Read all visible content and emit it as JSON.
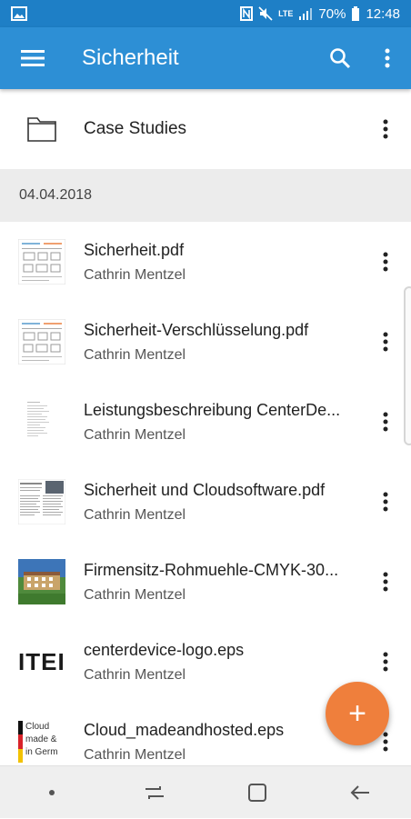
{
  "status_bar": {
    "battery_text": "70%",
    "time": "12:48",
    "network": "LTE"
  },
  "app_bar": {
    "title": "Sicherheit",
    "color": "#2d8fd5"
  },
  "folder": {
    "name": "Case Studies"
  },
  "date_group": {
    "label": "04.04.2018"
  },
  "files": [
    {
      "name": "Sicherheit.pdf",
      "owner": "Cathrin Mentzel",
      "thumb": "doc-chart"
    },
    {
      "name": "Sicherheit-Verschlüsselung.pdf",
      "owner": "Cathrin Mentzel",
      "thumb": "doc-chart"
    },
    {
      "name": "Leistungsbeschreibung CenterDe...",
      "owner": "Cathrin Mentzel",
      "thumb": "doc-text"
    },
    {
      "name": "Sicherheit und Cloudsoftware.pdf",
      "owner": "Cathrin Mentzel",
      "thumb": "doc-photo"
    },
    {
      "name": "Firmensitz-Rohmuehle-CMYK-30...",
      "owner": "Cathrin Mentzel",
      "thumb": "photo-building"
    },
    {
      "name": "centerdevice-logo.eps",
      "owner": "Cathrin Mentzel",
      "thumb": "logo-text",
      "thumb_text": "ITEI"
    },
    {
      "name": "Cloud_madeandhosted.eps",
      "owner": "Cathrin Mentzel",
      "thumb": "flag-text",
      "thumb_lines": [
        "Cloud",
        "made &",
        "in Germ"
      ]
    }
  ],
  "fab": {
    "label": "+",
    "color": "#ef7f3c"
  }
}
